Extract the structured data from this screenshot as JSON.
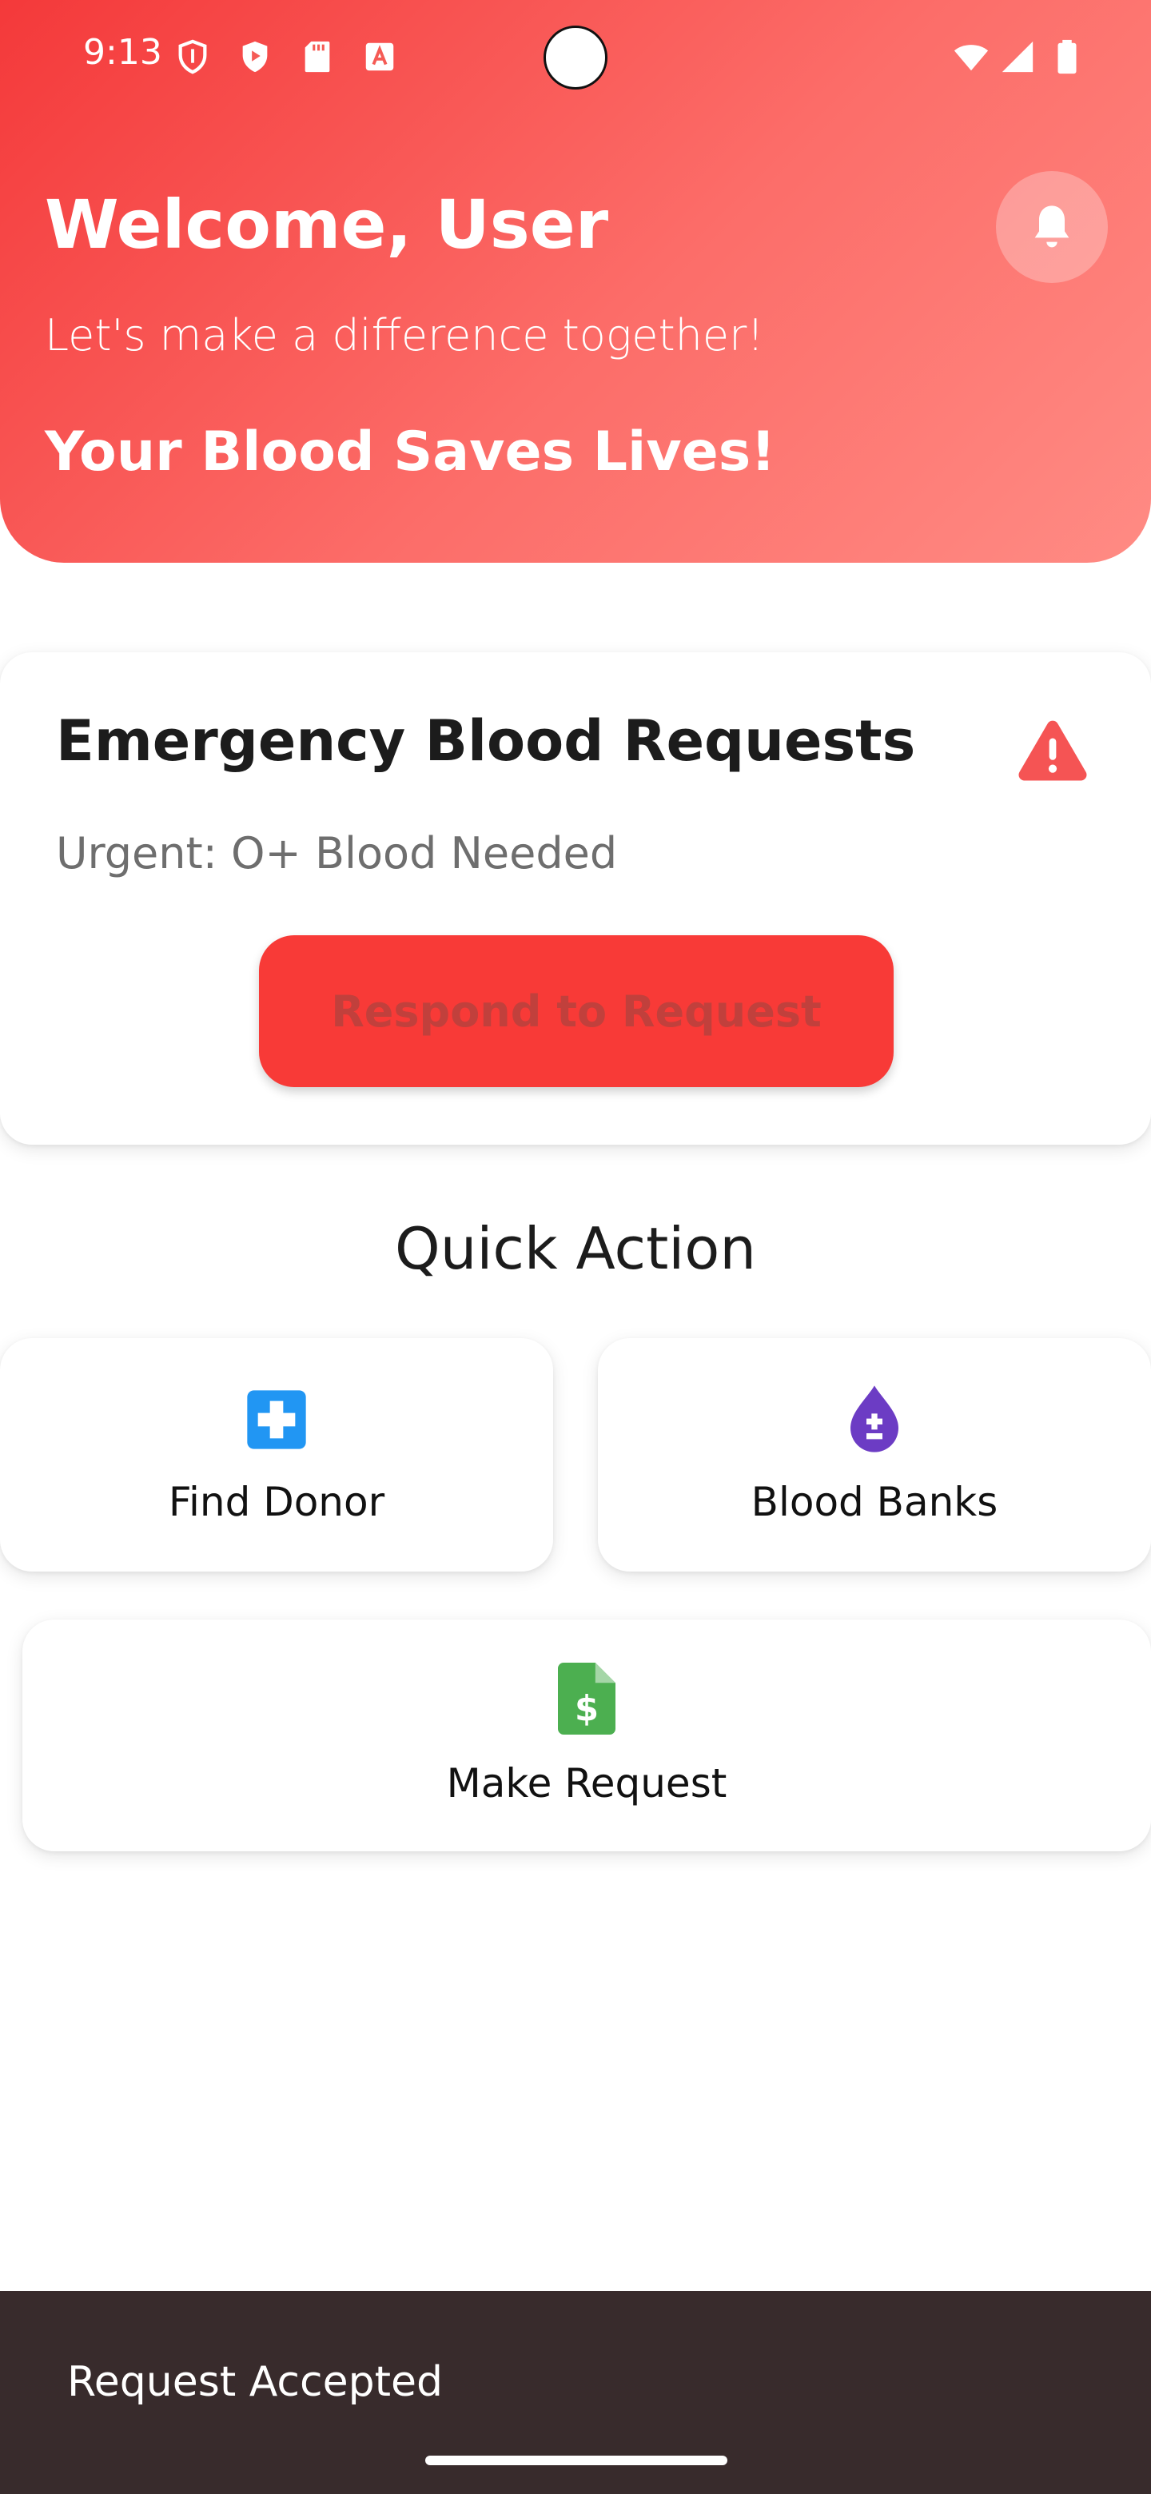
{
  "status_bar": {
    "time": "9:13",
    "left_icons": [
      "shield-icon",
      "play-protect-icon",
      "sd-card-icon",
      "font-a-icon"
    ],
    "right_icons": [
      "wifi-icon",
      "signal-icon",
      "battery-icon"
    ]
  },
  "header": {
    "title": "Welcome, User",
    "subtitle": "Let's make a difference together!",
    "tagline": "Your Blood Saves Lives!",
    "notification_icon": "bell-icon"
  },
  "emergency": {
    "title": "Emergency Blood Requests",
    "icon": "warning-icon",
    "message": "Urgent: O+ Blood Needed",
    "button_label": "Respond to Request"
  },
  "quick_action": {
    "title": "Quick Action",
    "items": [
      {
        "label": "Find Donor",
        "icon": "medical-cross-icon",
        "color": "#2196f3"
      },
      {
        "label": "Blood Banks",
        "icon": "blood-drop-icon",
        "color": "#6c3cc4"
      },
      {
        "label": "Make Request",
        "icon": "dollar-document-icon",
        "color": "#4caf50"
      }
    ]
  },
  "snackbar": {
    "message": "Request Accepted"
  },
  "colors": {
    "primary_red": "#f83a37",
    "header_gradient_start": "#f4393a",
    "header_gradient_end": "#ff8b84",
    "snackbar_bg": "#382b2c"
  }
}
